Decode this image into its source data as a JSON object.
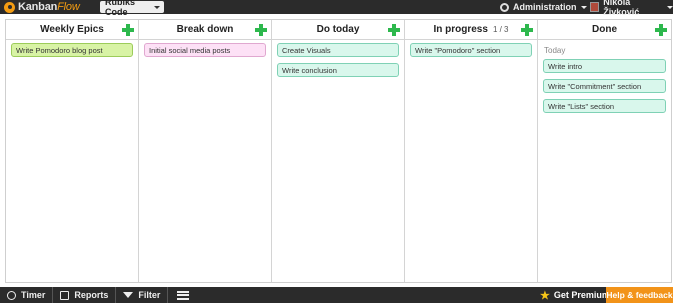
{
  "app": {
    "logo_main": "Kanban",
    "logo_accent": "Flow"
  },
  "header": {
    "board_name": "Rubiks Code",
    "admin_label": "Administration",
    "user_name": "Nikola Živković"
  },
  "columns": [
    {
      "title": "Weekly Epics",
      "wip": "",
      "tasks": [
        {
          "text": "Write Pomodoro blog post",
          "color": "green"
        }
      ]
    },
    {
      "title": "Break down",
      "wip": "",
      "tasks": [
        {
          "text": "Initial social media posts",
          "color": "pink"
        }
      ]
    },
    {
      "title": "Do today",
      "wip": "",
      "tasks": [
        {
          "text": "Create Visuals",
          "color": "teal"
        },
        {
          "text": "Write conclusion",
          "color": "teal"
        }
      ]
    },
    {
      "title": "In progress",
      "wip": "1 / 3",
      "tasks": [
        {
          "text": "Write \"Pomodoro\" section",
          "color": "teal"
        }
      ]
    },
    {
      "title": "Done",
      "wip": "",
      "group": "Today",
      "tasks": [
        {
          "text": "Write intro",
          "color": "teal"
        },
        {
          "text": "Write \"Commitment\" section",
          "color": "teal"
        },
        {
          "text": "Write \"Lists\" section",
          "color": "teal"
        }
      ]
    }
  ],
  "footer": {
    "timer_label": "Timer",
    "reports_label": "Reports",
    "filter_label": "Filter",
    "premium_label": "Get Premium",
    "help_label": "Help & feedback"
  },
  "colors": {
    "accent": "#f29319",
    "add": "#2db84d",
    "topbar": "#2b2b2b"
  }
}
